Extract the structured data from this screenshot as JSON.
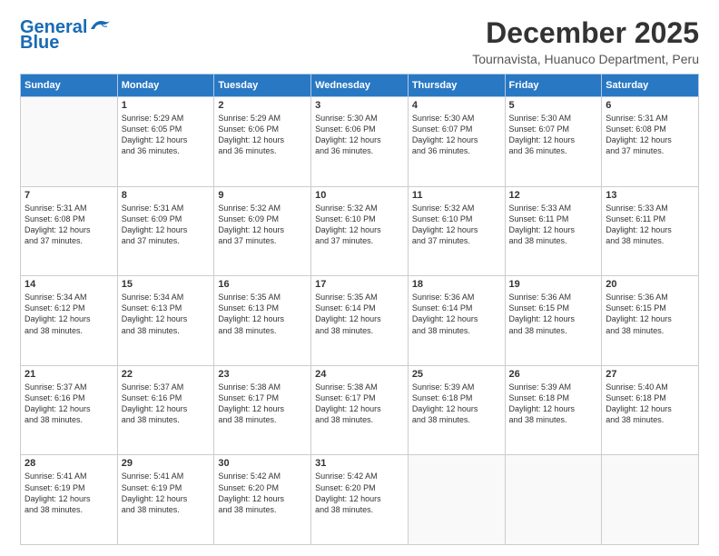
{
  "logo": {
    "line1": "General",
    "line2": "Blue"
  },
  "title": "December 2025",
  "subtitle": "Tournavista, Huanuco Department, Peru",
  "days_of_week": [
    "Sunday",
    "Monday",
    "Tuesday",
    "Wednesday",
    "Thursday",
    "Friday",
    "Saturday"
  ],
  "weeks": [
    [
      {
        "day": "",
        "info": ""
      },
      {
        "day": "1",
        "info": "Sunrise: 5:29 AM\nSunset: 6:05 PM\nDaylight: 12 hours\nand 36 minutes."
      },
      {
        "day": "2",
        "info": "Sunrise: 5:29 AM\nSunset: 6:06 PM\nDaylight: 12 hours\nand 36 minutes."
      },
      {
        "day": "3",
        "info": "Sunrise: 5:30 AM\nSunset: 6:06 PM\nDaylight: 12 hours\nand 36 minutes."
      },
      {
        "day": "4",
        "info": "Sunrise: 5:30 AM\nSunset: 6:07 PM\nDaylight: 12 hours\nand 36 minutes."
      },
      {
        "day": "5",
        "info": "Sunrise: 5:30 AM\nSunset: 6:07 PM\nDaylight: 12 hours\nand 36 minutes."
      },
      {
        "day": "6",
        "info": "Sunrise: 5:31 AM\nSunset: 6:08 PM\nDaylight: 12 hours\nand 37 minutes."
      }
    ],
    [
      {
        "day": "7",
        "info": "Sunrise: 5:31 AM\nSunset: 6:08 PM\nDaylight: 12 hours\nand 37 minutes."
      },
      {
        "day": "8",
        "info": "Sunrise: 5:31 AM\nSunset: 6:09 PM\nDaylight: 12 hours\nand 37 minutes."
      },
      {
        "day": "9",
        "info": "Sunrise: 5:32 AM\nSunset: 6:09 PM\nDaylight: 12 hours\nand 37 minutes."
      },
      {
        "day": "10",
        "info": "Sunrise: 5:32 AM\nSunset: 6:10 PM\nDaylight: 12 hours\nand 37 minutes."
      },
      {
        "day": "11",
        "info": "Sunrise: 5:32 AM\nSunset: 6:10 PM\nDaylight: 12 hours\nand 37 minutes."
      },
      {
        "day": "12",
        "info": "Sunrise: 5:33 AM\nSunset: 6:11 PM\nDaylight: 12 hours\nand 38 minutes."
      },
      {
        "day": "13",
        "info": "Sunrise: 5:33 AM\nSunset: 6:11 PM\nDaylight: 12 hours\nand 38 minutes."
      }
    ],
    [
      {
        "day": "14",
        "info": "Sunrise: 5:34 AM\nSunset: 6:12 PM\nDaylight: 12 hours\nand 38 minutes."
      },
      {
        "day": "15",
        "info": "Sunrise: 5:34 AM\nSunset: 6:13 PM\nDaylight: 12 hours\nand 38 minutes."
      },
      {
        "day": "16",
        "info": "Sunrise: 5:35 AM\nSunset: 6:13 PM\nDaylight: 12 hours\nand 38 minutes."
      },
      {
        "day": "17",
        "info": "Sunrise: 5:35 AM\nSunset: 6:14 PM\nDaylight: 12 hours\nand 38 minutes."
      },
      {
        "day": "18",
        "info": "Sunrise: 5:36 AM\nSunset: 6:14 PM\nDaylight: 12 hours\nand 38 minutes."
      },
      {
        "day": "19",
        "info": "Sunrise: 5:36 AM\nSunset: 6:15 PM\nDaylight: 12 hours\nand 38 minutes."
      },
      {
        "day": "20",
        "info": "Sunrise: 5:36 AM\nSunset: 6:15 PM\nDaylight: 12 hours\nand 38 minutes."
      }
    ],
    [
      {
        "day": "21",
        "info": "Sunrise: 5:37 AM\nSunset: 6:16 PM\nDaylight: 12 hours\nand 38 minutes."
      },
      {
        "day": "22",
        "info": "Sunrise: 5:37 AM\nSunset: 6:16 PM\nDaylight: 12 hours\nand 38 minutes."
      },
      {
        "day": "23",
        "info": "Sunrise: 5:38 AM\nSunset: 6:17 PM\nDaylight: 12 hours\nand 38 minutes."
      },
      {
        "day": "24",
        "info": "Sunrise: 5:38 AM\nSunset: 6:17 PM\nDaylight: 12 hours\nand 38 minutes."
      },
      {
        "day": "25",
        "info": "Sunrise: 5:39 AM\nSunset: 6:18 PM\nDaylight: 12 hours\nand 38 minutes."
      },
      {
        "day": "26",
        "info": "Sunrise: 5:39 AM\nSunset: 6:18 PM\nDaylight: 12 hours\nand 38 minutes."
      },
      {
        "day": "27",
        "info": "Sunrise: 5:40 AM\nSunset: 6:18 PM\nDaylight: 12 hours\nand 38 minutes."
      }
    ],
    [
      {
        "day": "28",
        "info": "Sunrise: 5:41 AM\nSunset: 6:19 PM\nDaylight: 12 hours\nand 38 minutes."
      },
      {
        "day": "29",
        "info": "Sunrise: 5:41 AM\nSunset: 6:19 PM\nDaylight: 12 hours\nand 38 minutes."
      },
      {
        "day": "30",
        "info": "Sunrise: 5:42 AM\nSunset: 6:20 PM\nDaylight: 12 hours\nand 38 minutes."
      },
      {
        "day": "31",
        "info": "Sunrise: 5:42 AM\nSunset: 6:20 PM\nDaylight: 12 hours\nand 38 minutes."
      },
      {
        "day": "",
        "info": ""
      },
      {
        "day": "",
        "info": ""
      },
      {
        "day": "",
        "info": ""
      }
    ]
  ]
}
